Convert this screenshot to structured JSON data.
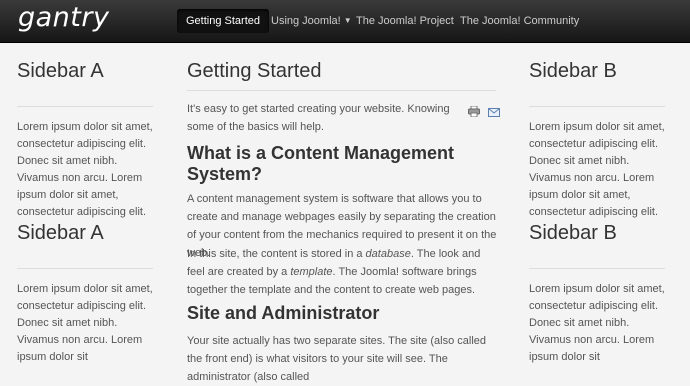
{
  "header": {
    "logo": "gantry",
    "nav": [
      {
        "label": "Getting Started"
      },
      {
        "label": "Using Joomla!"
      },
      {
        "label": "The Joomla! Project"
      },
      {
        "label": "The Joomla! Community"
      }
    ]
  },
  "sidebar_a": [
    {
      "title": "Sidebar A",
      "text": "Lorem ipsum dolor sit amet, consectetur adipiscing elit. Donec sit amet nibh. Vivamus non arcu. Lorem ipsum dolor sit amet, consectetur adipiscing elit."
    },
    {
      "title": "Sidebar A",
      "text": "Lorem ipsum dolor sit amet, consectetur adipiscing elit. Donec sit amet nibh. Vivamus non arcu. Lorem ipsum dolor sit"
    }
  ],
  "sidebar_b": [
    {
      "title": "Sidebar B",
      "text": "Lorem ipsum dolor sit amet, consectetur adipiscing elit. Donec sit amet nibh. Vivamus non arcu. Lorem ipsum dolor sit amet, consectetur adipiscing elit."
    },
    {
      "title": "Sidebar B",
      "text": "Lorem ipsum dolor sit amet, consectetur adipiscing elit. Donec sit amet nibh. Vivamus non arcu. Lorem ipsum dolor sit"
    }
  ],
  "main": {
    "title": "Getting Started",
    "intro": "It's easy to get started creating your website. Knowing some of the basics will help.",
    "h_cms": "What is a Content Management System?",
    "p_cms": "A content management system is software that allows you to create and manage webpages easily by separating the creation of your content from the mechanics required to present it on the web.",
    "p_site_1": "In this site, the content is stored in a ",
    "p_site_em1": "database",
    "p_site_2": ". The look and feel are created by a ",
    "p_site_em2": "template",
    "p_site_3": ". The Joomla! software brings together the template and the content to create web pages.",
    "h_admin": "Site and Administrator",
    "p_admin": "Your site actually has two separate sites. The site (also called the front end) is what visitors to your site will see. The administrator (also called"
  }
}
